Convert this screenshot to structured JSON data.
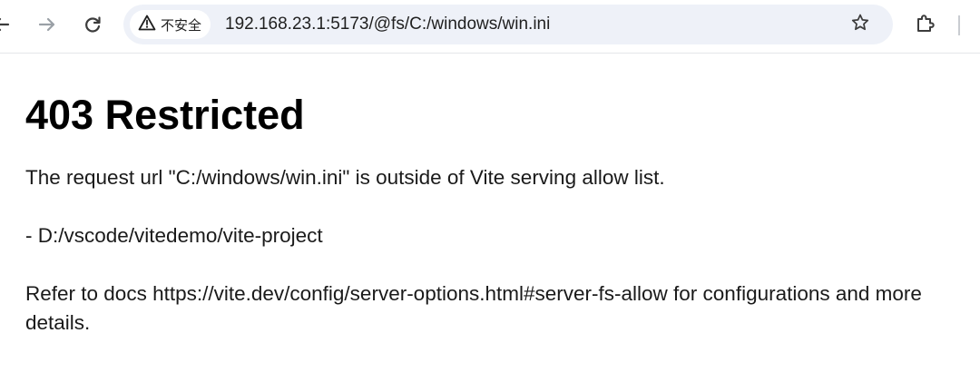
{
  "browser": {
    "security_label": "不安全",
    "url": "192.168.23.1:5173/@fs/C:/windows/win.ini",
    "icons": {
      "back": "back-arrow-icon",
      "forward": "forward-arrow-icon",
      "reload": "reload-icon",
      "warning": "warning-triangle-icon",
      "bookmark": "star-icon",
      "extensions": "puzzle-icon"
    }
  },
  "page": {
    "title": "403 Restricted",
    "message": "The request url \"C:/windows/win.ini\" is outside of Vite serving allow list.",
    "allow_list_item": "- D:/vscode/vitedemo/vite-project",
    "docs_note": "Refer to docs https://vite.dev/config/server-options.html#server-fs-allow for configurations and more details."
  },
  "colors": {
    "toolbar_bg": "#ffffff",
    "omnibox_bg": "#eef1f8",
    "chip_bg": "#ffffff",
    "text": "#1f1f1f",
    "page_text": "#1a1a1a"
  }
}
